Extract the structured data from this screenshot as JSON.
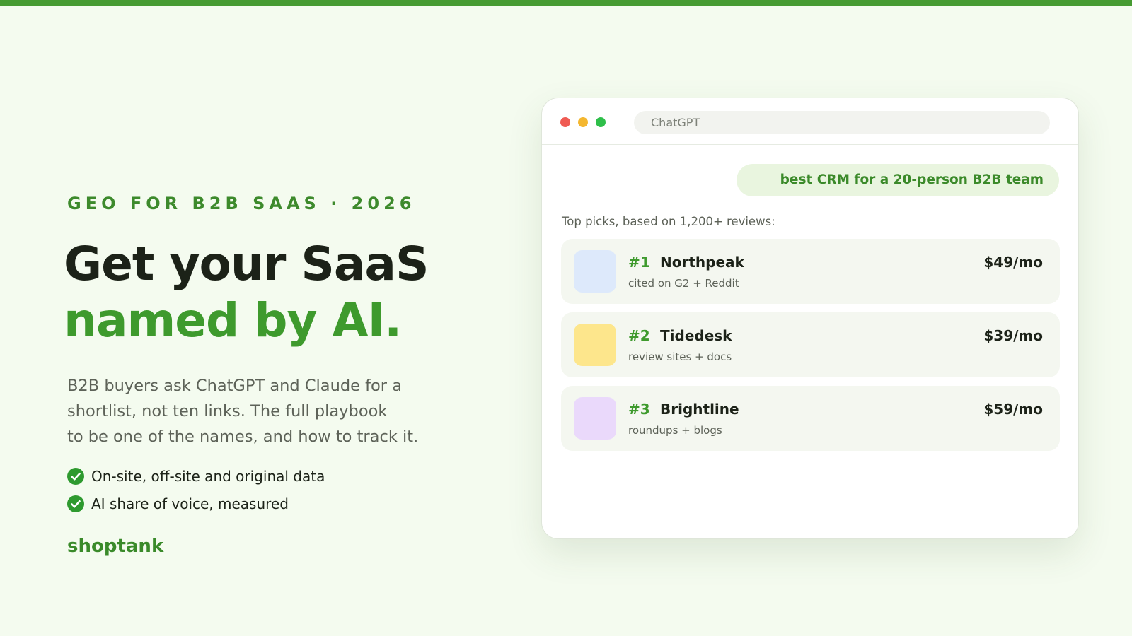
{
  "colors": {
    "accent": "#469b32",
    "headline_green": "#3e9a2d",
    "background": "#f4fbef",
    "check_green": "#2e9a2f"
  },
  "hero": {
    "eyebrow": "GEO FOR B2B SAAS · 2026",
    "headline_line1": "Get your SaaS",
    "headline_line2": "named by AI.",
    "subtext_lines": [
      "B2B buyers ask ChatGPT and Claude for a",
      "shortlist, not ten links. The full playbook",
      "to be one of the names, and how to track it."
    ],
    "checks": [
      "On-site, off-site and original data",
      "AI share of voice, measured"
    ],
    "brand": "shoptank"
  },
  "window": {
    "address": "ChatGPT",
    "query": "best CRM for a 20-person B2B team",
    "intro": "Top picks, based on 1,200+ reviews:",
    "results": [
      {
        "rank": "#1",
        "name": "Northpeak",
        "sub": "cited on G2 + Reddit",
        "price": "$49/mo",
        "swatch": "#dde9fb"
      },
      {
        "rank": "#2",
        "name": "Tidedesk",
        "sub": "review sites + docs",
        "price": "$39/mo",
        "swatch": "#fde68c"
      },
      {
        "rank": "#3",
        "name": "Brightline",
        "sub": "roundups + blogs",
        "price": "$59/mo",
        "swatch": "#ead9fb"
      }
    ],
    "icons": {
      "close": "close-dot-icon",
      "minimize": "minimize-dot-icon",
      "maximize": "maximize-dot-icon",
      "check": "check-circle-icon"
    }
  }
}
